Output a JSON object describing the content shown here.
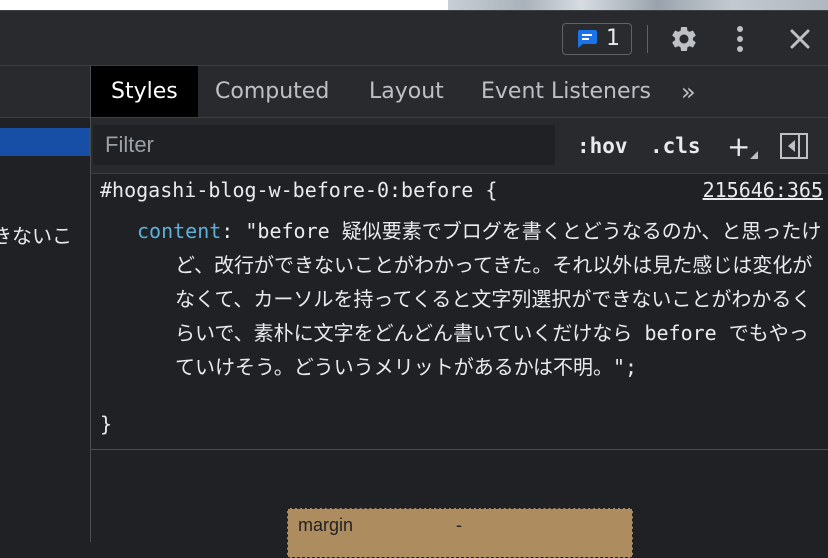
{
  "toolbar": {
    "issues_count": "1",
    "icons": [
      "message-icon",
      "gear-icon",
      "more-vert-icon",
      "close-icon"
    ]
  },
  "left_pane": {
    "dom_text_fragment": "きないこ"
  },
  "tabs": [
    {
      "label": "Styles",
      "active": true
    },
    {
      "label": "Computed",
      "active": false
    },
    {
      "label": "Layout",
      "active": false
    },
    {
      "label": "Event Listeners",
      "active": false
    }
  ],
  "tabs_overflow": "»",
  "filter": {
    "placeholder": "Filter",
    "value": "",
    "hov_label": ":hov",
    "cls_label": ".cls",
    "add_rule_label": "+"
  },
  "rule": {
    "selector": "#hogashi-blog-w-before-0:before {",
    "source": "215646:365",
    "property": "content",
    "colon": ": ",
    "value": "\"before 疑似要素でブログを書くとどうなるのか、と思ったけど、改行ができないことがわかってきた。それ以外は見た感じは変化がなくて、カーソルを持ってくると文字列選択ができないことがわかるくらいで、素朴に文字をどんどん書いていくだけなら before でもやっていけそう。どういうメリットがあるかは不明。\";",
    "close": "}"
  },
  "box_model": {
    "margin_label": "margin",
    "margin_value": "-"
  },
  "colors": {
    "panel_bg": "#202124",
    "toolbar_bg": "#292a2d",
    "selected_row": "#174ea6",
    "property_color": "#5db0d7",
    "margin_box": "#ad8c5f",
    "badge_icon": "#1a73e8"
  }
}
